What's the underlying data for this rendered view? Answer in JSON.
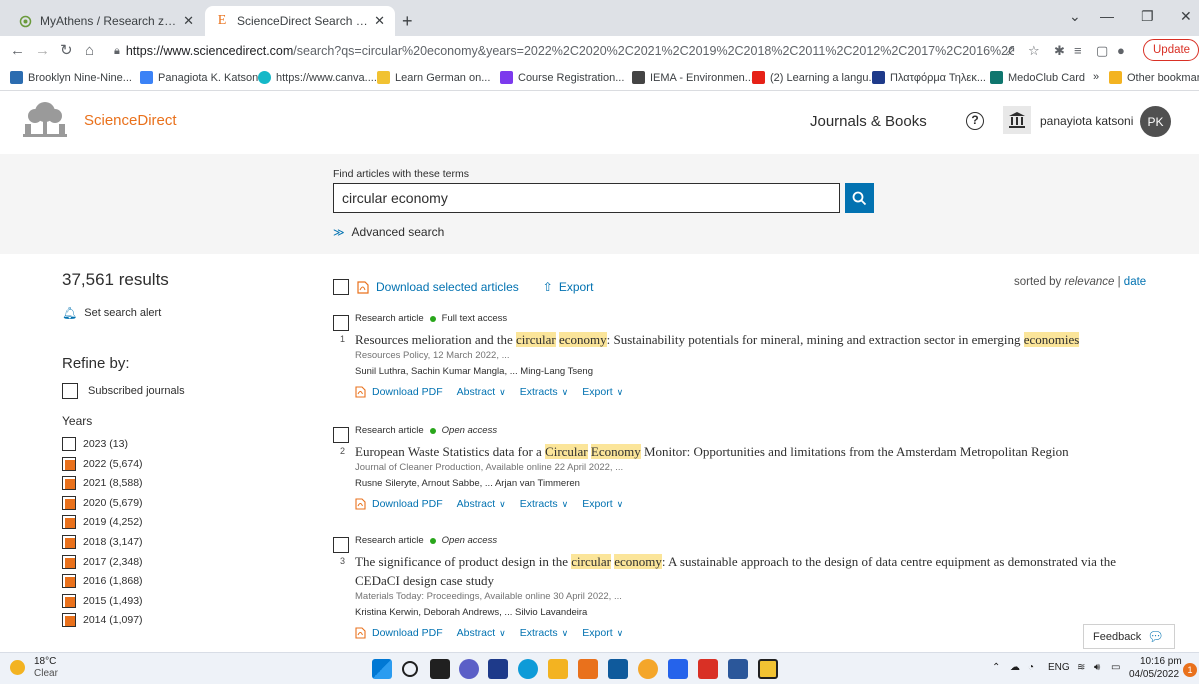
{
  "browser": {
    "tabs": [
      {
        "label": "MyAthens / Research zone",
        "active": false
      },
      {
        "label": "ScienceDirect Search Results - Ke",
        "active": true
      }
    ],
    "url_host": "https://www.sciencedirect.com",
    "url_path": "/search?qs=circular%20economy&years=2022%2C2020%2C2021%2C2019%2C2018%2C2011%2C2012%2C2017%2C2016%2C2013%2C2014...",
    "update_label": "Update",
    "bookmarks": [
      "Brooklyn Nine-Nine...",
      "Panagiota K. Katson...",
      "https://www.canva....",
      "Learn German on...",
      "Course Registration...",
      "IEMA - Environmen...",
      "(2) Learning a langu...",
      "Πλατφόρμα Τηλεκ...",
      "MedoClub Card"
    ],
    "bookmarks_more": "»",
    "other_bookmarks": "Other bookmarks"
  },
  "header": {
    "logo_text": "ScienceDirect",
    "journals_books": "Journals & Books",
    "help": "?",
    "username": "panayiota katsoni",
    "avatar_initials": "PK"
  },
  "search": {
    "label": "Find articles with these terms",
    "value": "circular economy",
    "advanced": "Advanced search"
  },
  "sidebar": {
    "results_count": "37,561 results",
    "set_alert": "Set search alert",
    "refine_by": "Refine by:",
    "subscribed": "Subscribed journals",
    "years_title": "Years",
    "years": [
      {
        "label": "2023 (13)",
        "checked": false
      },
      {
        "label": "2022 (5,674)",
        "checked": true
      },
      {
        "label": "2021 (8,588)",
        "checked": true
      },
      {
        "label": "2020 (5,679)",
        "checked": true
      },
      {
        "label": "2019 (4,252)",
        "checked": true
      },
      {
        "label": "2018 (3,147)",
        "checked": true
      },
      {
        "label": "2017 (2,348)",
        "checked": true
      },
      {
        "label": "2016 (1,868)",
        "checked": true
      },
      {
        "label": "2015 (1,493)",
        "checked": true
      },
      {
        "label": "2014 (1,097)",
        "checked": true
      }
    ]
  },
  "results_toolbar": {
    "download_selected": "Download selected articles",
    "export": "Export",
    "sorted_by": "sorted by",
    "relevance": "relevance",
    "separator": "|",
    "date": "date"
  },
  "results": [
    {
      "num": "1",
      "type": "Research article",
      "access": "Full text access",
      "access_italic": false,
      "title_parts": [
        {
          "t": "Resources melioration and the ",
          "h": false
        },
        {
          "t": "circular",
          "h": true
        },
        {
          "t": " ",
          "h": false
        },
        {
          "t": "economy",
          "h": true
        },
        {
          "t": ": Sustainability potentials for mineral, mining and extraction sector in emerging ",
          "h": false
        },
        {
          "t": "economies",
          "h": true
        }
      ],
      "source": "Resources Policy, 12 March 2022, ...",
      "authors": "Sunil Luthra, Sachin Kumar Mangla, ... Ming-Lang Tseng"
    },
    {
      "num": "2",
      "type": "Research article",
      "access": "Open access",
      "access_italic": true,
      "title_parts": [
        {
          "t": "European Waste Statistics data for a ",
          "h": false
        },
        {
          "t": "Circular",
          "h": true
        },
        {
          "t": " ",
          "h": false
        },
        {
          "t": "Economy",
          "h": true
        },
        {
          "t": " Monitor: Opportunities and limitations from the Amsterdam Metropolitan Region",
          "h": false
        }
      ],
      "source": "Journal of Cleaner Production, Available online 22 April 2022, ...",
      "authors": "Rusne Sileryte, Arnout Sabbe, ... Arjan van Timmeren"
    },
    {
      "num": "3",
      "type": "Research article",
      "access": "Open access",
      "access_italic": true,
      "title_parts": [
        {
          "t": "The significance of product design in the ",
          "h": false
        },
        {
          "t": "circular",
          "h": true
        },
        {
          "t": " ",
          "h": false
        },
        {
          "t": "economy",
          "h": true
        },
        {
          "t": ": A sustainable approach to the design of data centre equipment as demonstrated via the CEDaCI design case study",
          "h": false
        }
      ],
      "source": "Materials Today: Proceedings, Available online 30 April 2022, ...",
      "authors": "Kristina Kerwin, Deborah Andrews, ... Silvio Lavandeira"
    }
  ],
  "result_actions": {
    "download_pdf": "Download PDF",
    "abstract": "Abstract",
    "extracts": "Extracts",
    "export": "Export"
  },
  "feedback": "Feedback",
  "taskbar": {
    "temp": "18°C",
    "condition": "Clear",
    "lang": "ENG",
    "time": "10:16 pm",
    "date": "04/05/2022",
    "notifications": "1"
  },
  "colors": {
    "accent_orange": "#e9711c",
    "link_blue": "#0272b1",
    "highlight": "#fbe59a",
    "access_green": "#29a61b"
  }
}
